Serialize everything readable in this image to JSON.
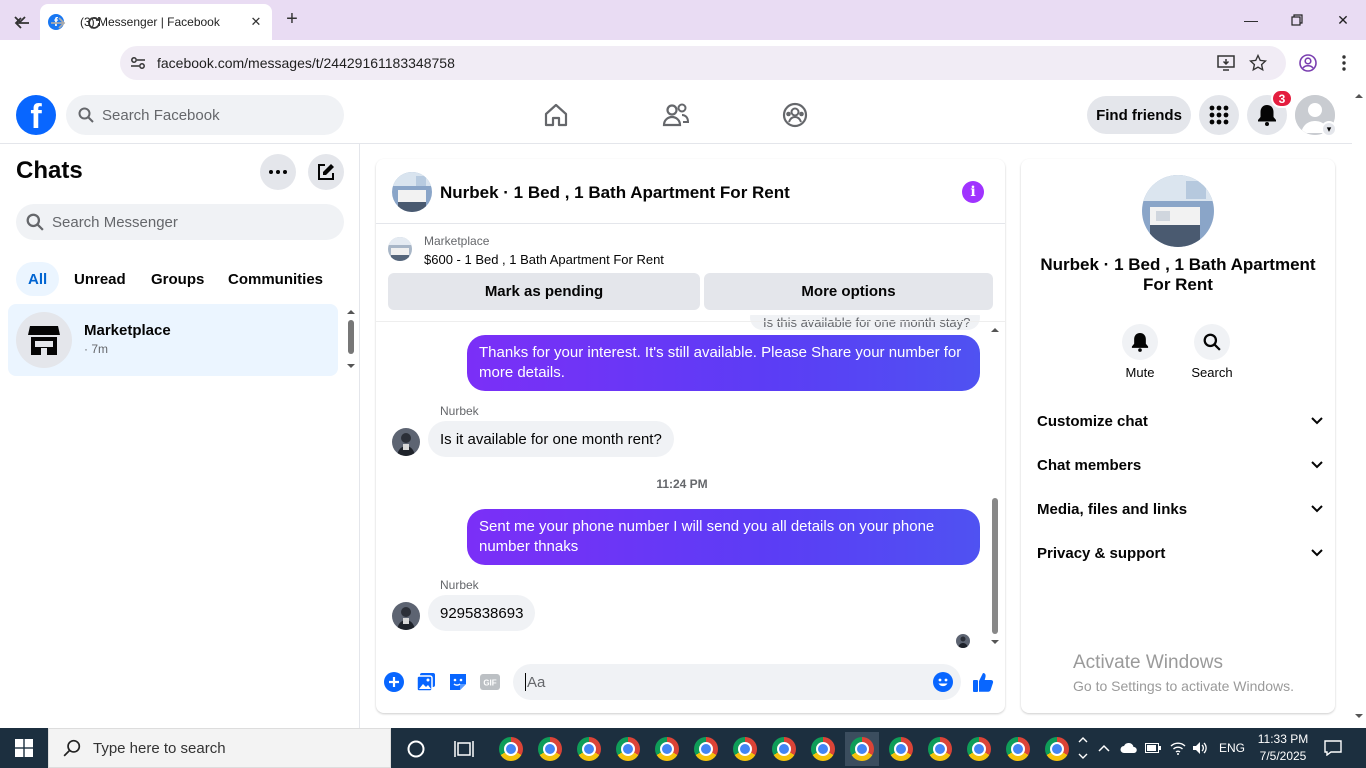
{
  "browser": {
    "tab_title": "(3) Messenger | Facebook",
    "url": "facebook.com/messages/t/24429161183348758"
  },
  "facebook": {
    "search_placeholder": "Search Facebook",
    "find_friends": "Find friends",
    "notification_count": "3"
  },
  "chats": {
    "title": "Chats",
    "search_placeholder": "Search Messenger",
    "filters": [
      "All",
      "Unread",
      "Groups",
      "Communities"
    ],
    "active_filter": "All",
    "items": [
      {
        "name": "Marketplace",
        "time": "· 7m"
      }
    ]
  },
  "conversation": {
    "title": "Nurbek · 1 Bed , 1 Bath Apartment For Rent",
    "marketplace_label": "Marketplace",
    "listing": "$600 - 1 Bed , 1 Bath Apartment For Rent",
    "mark_pending": "Mark as pending",
    "more_options": "More options",
    "partial_message": "Is this available for one month stay?",
    "messages": [
      {
        "from": "me",
        "text": "Thanks for your interest.  It's still available. Please Share your number for more details."
      },
      {
        "from": "Nurbek",
        "sender": "Nurbek",
        "text": "Is it available for one month rent?"
      },
      {
        "timestamp": "11:24 PM"
      },
      {
        "from": "me",
        "text": "Sent me your phone number I will send you all details on your phone number thnaks"
      },
      {
        "from": "Nurbek",
        "sender": "Nurbek",
        "text": "9295838693"
      }
    ],
    "composer_placeholder": "Aa"
  },
  "info_panel": {
    "name": "Nurbek · 1 Bed , 1 Bath Apartment For Rent",
    "actions": [
      "Mute",
      "Search"
    ],
    "sections": [
      "Customize chat",
      "Chat members",
      "Media, files and links",
      "Privacy & support"
    ]
  },
  "watermark": {
    "line1": "Activate Windows",
    "line2": "Go to Settings to activate Windows."
  },
  "taskbar": {
    "search_placeholder": "Type here to search",
    "language": "ENG",
    "time": "11:33 PM",
    "date": "7/5/2025"
  },
  "colors": {
    "facebook_blue": "#0866ff",
    "messenger_purple": "#7b2ff7",
    "badge_red": "#e41e3f"
  }
}
